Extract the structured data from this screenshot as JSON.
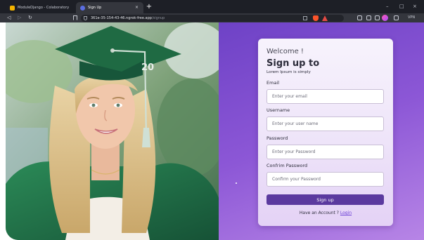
{
  "browser": {
    "tabs": [
      {
        "title": "ModuleDjango - Colaboratory",
        "active": false
      },
      {
        "title": "Sign Up",
        "active": true
      }
    ],
    "url": "361e-35-154-43-46.ngrok-free.app",
    "url_path": "/signup",
    "vpn_label": "VPN",
    "new_tab_glyph": "+",
    "close_tab_glyph": "×",
    "nav_glyphs": {
      "back": "◁",
      "forward": "▷",
      "reload": "↻"
    },
    "window_glyphs": {
      "minimize": "–",
      "maximize": "□",
      "close": "×"
    },
    "icons": [
      "tab-favicon",
      "bookmark-icon",
      "shield-icon",
      "share-icon",
      "brave-shields-icon",
      "brave-rewards-icon",
      "extensions-icon",
      "sidebar-icon",
      "wallet-icon",
      "leo-ai-icon",
      "menu-icon"
    ]
  },
  "hero": {
    "cap_year": "20"
  },
  "form": {
    "welcome": "Welcome !",
    "heading": "Sign up to",
    "subheading": "Lorem Ipsum is simply",
    "fields": [
      {
        "label": "Email",
        "placeholder": "Enter your email",
        "value": ""
      },
      {
        "label": "Username",
        "placeholder": "Enter your user name",
        "value": ""
      },
      {
        "label": "Password",
        "placeholder": "Enter your Password",
        "value": ""
      },
      {
        "label": "Confrim Password",
        "placeholder": "Confirm your Password",
        "value": ""
      }
    ],
    "submit_label": "Sign up",
    "login_prompt": "Have an Account ?",
    "login_link": "Login"
  },
  "colors": {
    "panel_purple": "#7a4bcc",
    "button_purple": "#5b3a9f",
    "gown_green": "#1f6a43"
  }
}
